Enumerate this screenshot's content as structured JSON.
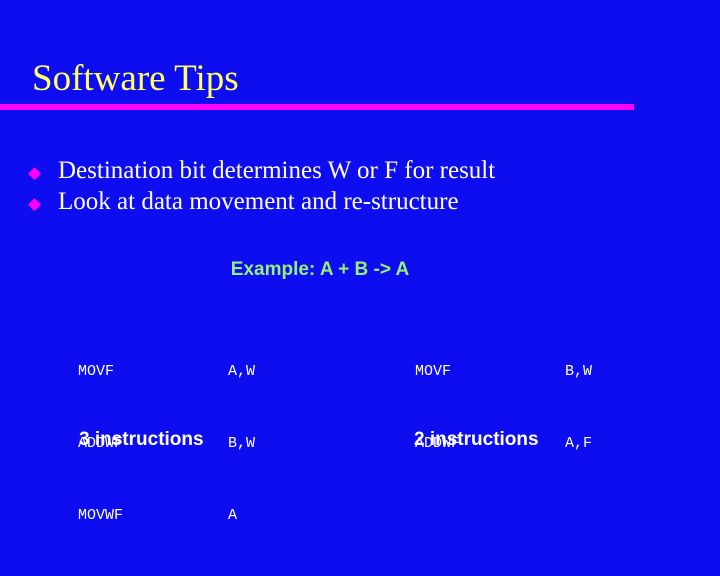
{
  "slide": {
    "title": "Software Tips",
    "background_color": "#0d0df0",
    "title_color": "#ffff66",
    "rule_color": "#ff00ff"
  },
  "bullets": [
    {
      "marker": "◆",
      "text": "Destination bit determines W or F for result"
    },
    {
      "marker": "◆",
      "text": "Look at data movement and re-structure"
    }
  ],
  "example": {
    "label": "Example:  A + B -> A",
    "color": "#99ee77"
  },
  "code_left": {
    "rows": [
      {
        "mnemonic": "MOVF",
        "operand": "A,W"
      },
      {
        "mnemonic": "ADDWF",
        "operand": "B,W"
      },
      {
        "mnemonic": "MOVWF",
        "operand": "A"
      }
    ],
    "caption": "3 instructions"
  },
  "code_right": {
    "rows": [
      {
        "mnemonic": "MOVF",
        "operand": "B,W"
      },
      {
        "mnemonic": "ADDWF",
        "operand": "A,F"
      }
    ],
    "caption": "2 instructions"
  }
}
